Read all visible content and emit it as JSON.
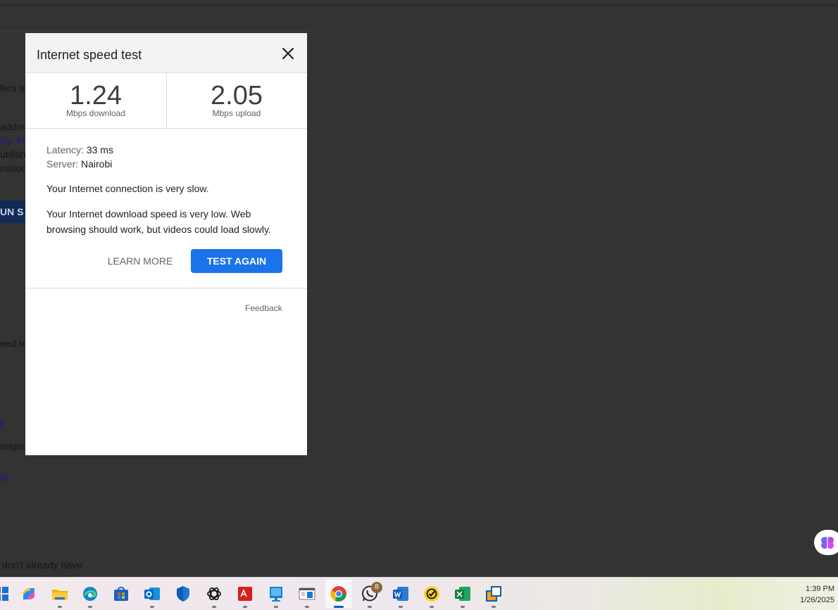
{
  "background_page": {
    "fragments": [
      "fers le",
      "addre",
      "icy. M",
      "ublishe",
      "nation",
      "eed te",
      "maps",
      "don't already have"
    ],
    "run_button_label": "UN S",
    "links": [
      "t",
      "lp"
    ]
  },
  "dialog": {
    "title": "Internet speed test",
    "download": {
      "value": "1.24",
      "unit": "Mbps download"
    },
    "upload": {
      "value": "2.05",
      "unit": "Mbps upload"
    },
    "latency_label": "Latency:",
    "latency_value": "33 ms",
    "server_label": "Server:",
    "server_value": "Nairobi",
    "message_1": "Your Internet connection is very slow.",
    "message_2": "Your Internet download speed is very low. Web browsing should work, but videos could load slowly.",
    "learn_more_label": "LEARN MORE",
    "test_again_label": "TEST AGAIN",
    "feedback_label": "Feedback"
  },
  "taskbar": {
    "apps": [
      "start-icon",
      "copilot-icon",
      "file-explorer-icon",
      "edge-icon",
      "store-icon",
      "outlook-icon",
      "defender-icon",
      "chatgpt-icon",
      "pdf-icon",
      "book-icon",
      "window-icon",
      "chrome-icon",
      "whatsapp-icon",
      "word-icon",
      "norton-icon",
      "excel-icon",
      "virtualbox-icon"
    ],
    "whatsapp_badge": "8",
    "time": "1:39 PM",
    "date": "1/26/2025"
  },
  "colors": {
    "accent": "#1a73e8",
    "backdrop": "#333333"
  }
}
